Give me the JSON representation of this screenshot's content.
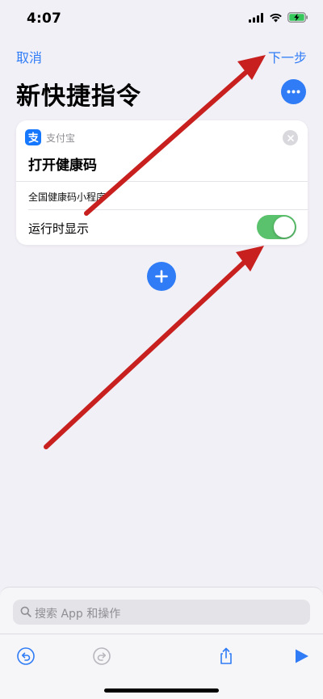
{
  "status_bar": {
    "time": "4:07"
  },
  "nav": {
    "cancel": "取消",
    "next": "下一步"
  },
  "page": {
    "title": "新快捷指令"
  },
  "action_card": {
    "app_name": "支付宝",
    "action_title": "打开健康码",
    "parameter": "全国健康码小程序",
    "toggle_label": "运行时显示",
    "toggle_on": true
  },
  "search": {
    "placeholder": "搜索 App 和操作"
  },
  "colors": {
    "accent": "#2f7cf6",
    "toggle_on": "#5ac16c",
    "annotation_arrow": "#c8201f",
    "alipay_blue": "#1677ff"
  },
  "icons": {
    "more": "ellipsis-icon",
    "close": "close-icon",
    "add": "plus-icon",
    "search": "search-icon",
    "undo": "undo-icon",
    "redo": "redo-icon",
    "share": "share-icon",
    "play": "play-icon"
  }
}
